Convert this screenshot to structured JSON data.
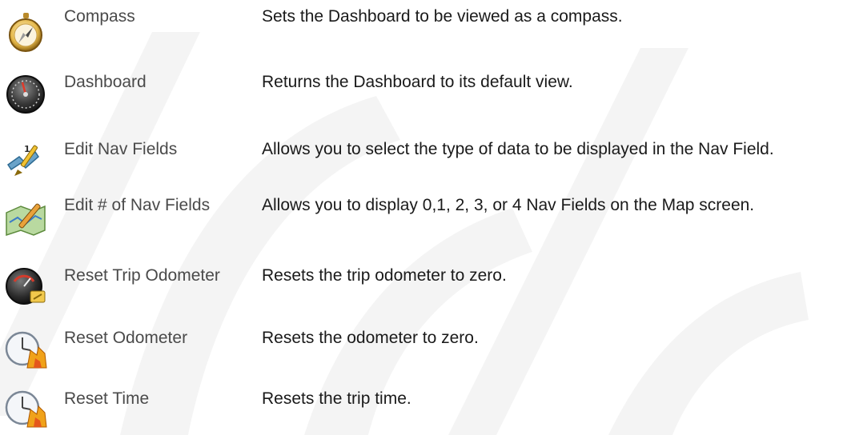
{
  "rows": [
    {
      "icon": "compass-icon",
      "name": "Compass",
      "description": "Sets the Dashboard to be viewed as a compass."
    },
    {
      "icon": "dashboard-gauge-icon",
      "name": "Dashboard",
      "description": "Returns the Dashboard to its default view."
    },
    {
      "icon": "edit-nav-fields-icon",
      "name": "Edit Nav Fields",
      "description": "Allows you to select the type of data to be displayed in the Nav Field."
    },
    {
      "icon": "map-edit-icon",
      "name": "Edit # of Nav Fields",
      "description": "Allows you to display 0,1, 2, 3, or 4 Nav Fields on the Map screen."
    },
    {
      "icon": "trip-odometer-gauge-icon",
      "name": "Reset Trip Odometer",
      "description": "Resets the trip odometer to zero."
    },
    {
      "icon": "reset-clock-icon",
      "name": "Reset Odometer",
      "description": "Resets the odometer to zero."
    },
    {
      "icon": "reset-clock-icon",
      "name": "Reset Time",
      "description": "Resets the trip time."
    }
  ]
}
